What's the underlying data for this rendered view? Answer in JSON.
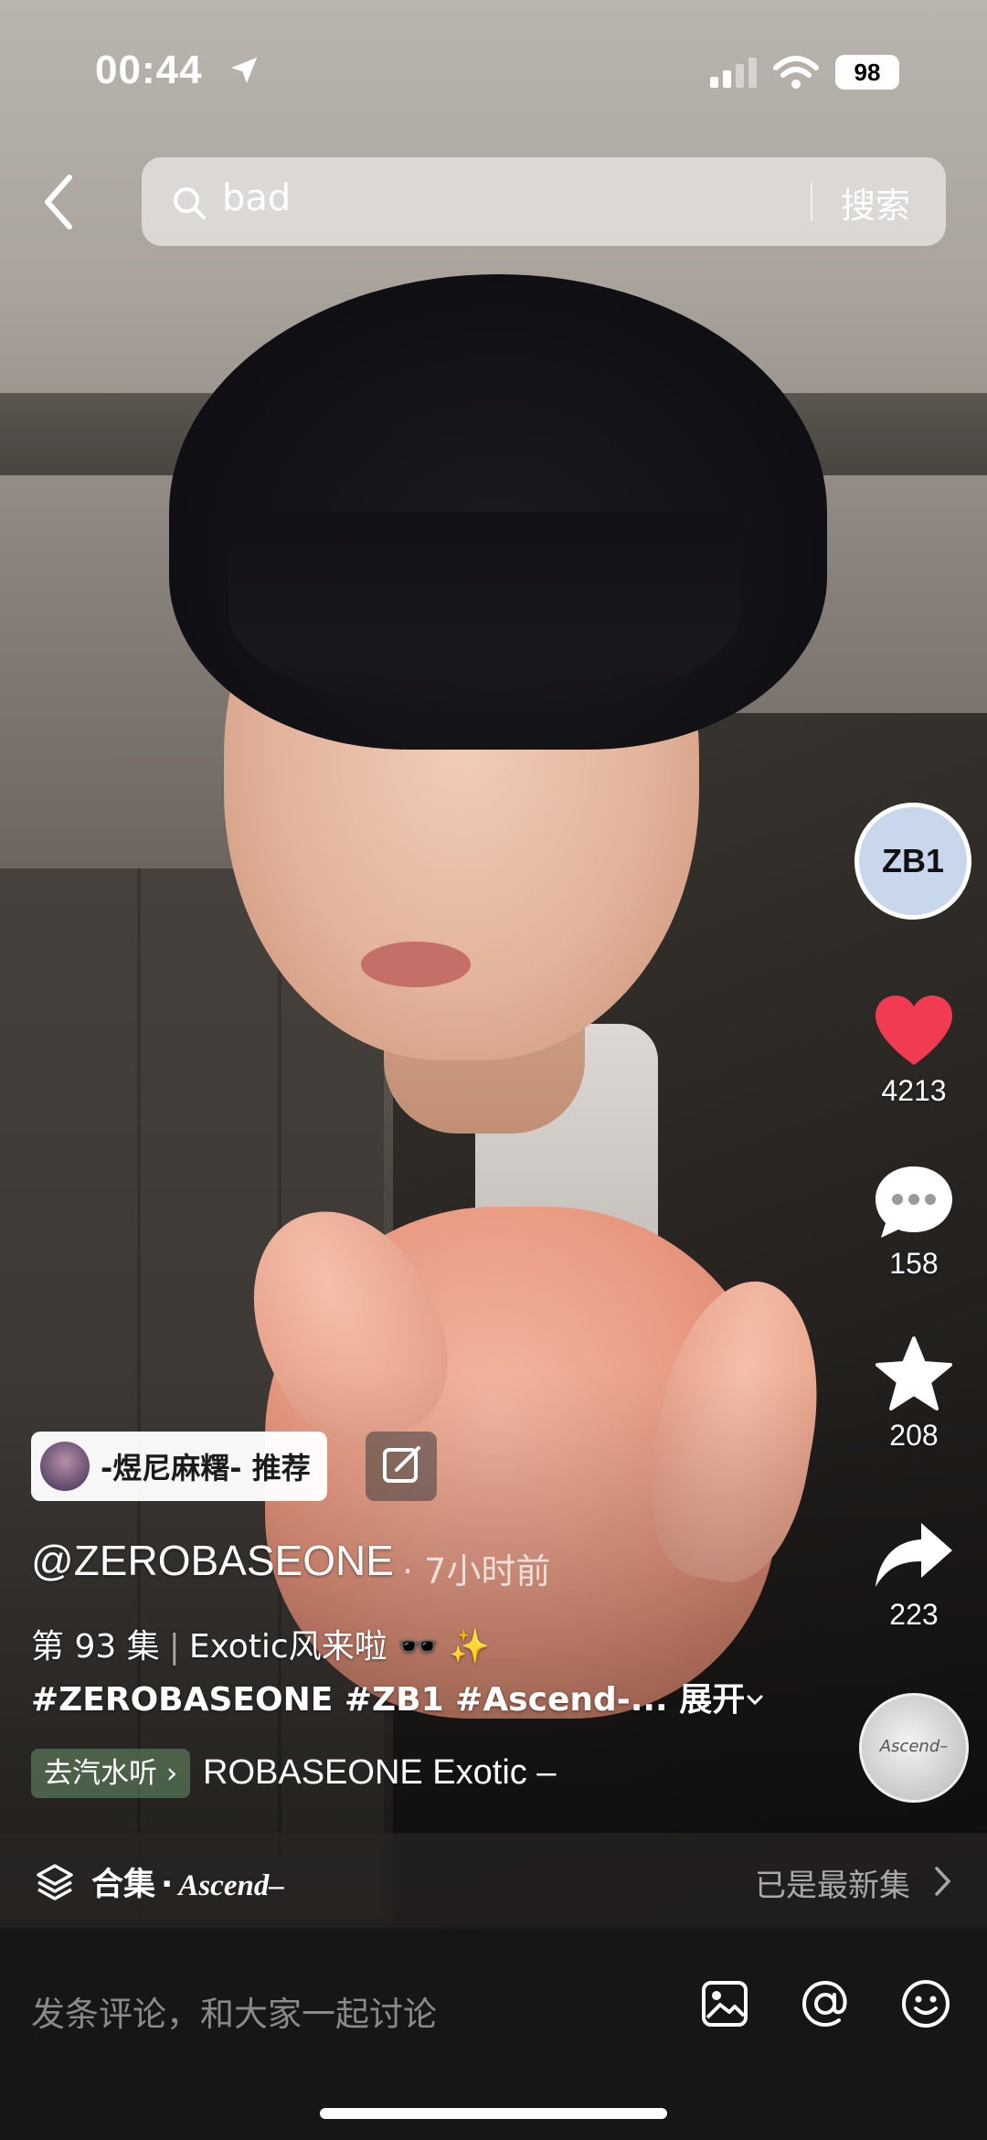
{
  "status_bar": {
    "time": "00:44",
    "battery": "98"
  },
  "search": {
    "query": "bad",
    "button_label": "搜索"
  },
  "creator": {
    "avatar_text": "ZB1"
  },
  "actions": {
    "likes": "4213",
    "comments": "158",
    "favorites": "208",
    "shares": "223"
  },
  "music_disc": {
    "label": "Ascend–"
  },
  "recommendation": {
    "text": "-煜尼麻糬- 推荐"
  },
  "post": {
    "author": "@ZEROBASEONE",
    "time_ago": "· 7小时前",
    "episode": "第 93 集",
    "caption": "Exotic风来啦 🕶️ ✨",
    "hashtags": "#ZEROBASEONE #ZB1 #Ascend-...",
    "expand_label": "展开"
  },
  "music": {
    "chip_label": "去汽水听 ›",
    "track": "ROBASEONE  Exotic –"
  },
  "collection": {
    "label": "合集",
    "name": "Ascend–",
    "status": "已是最新集"
  },
  "comment_bar": {
    "placeholder": "发条评论，和大家一起讨论"
  },
  "colors": {
    "like": "#f03b52",
    "panel": "#161616"
  }
}
